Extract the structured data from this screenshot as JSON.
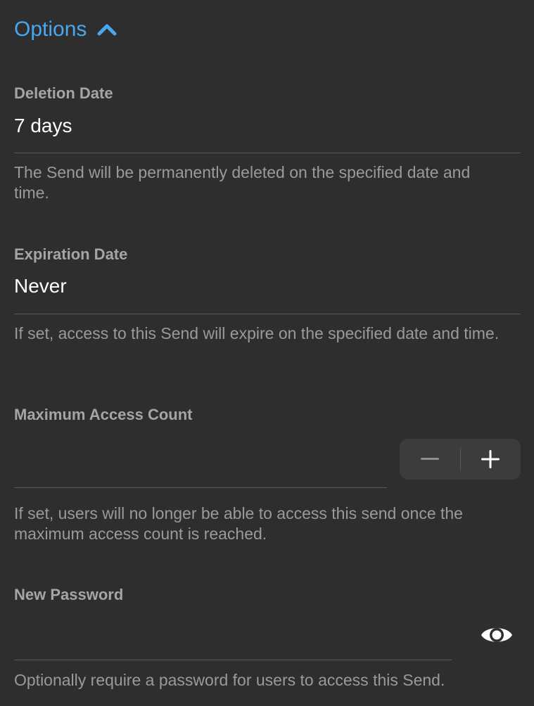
{
  "options": {
    "label": "Options",
    "expanded": true,
    "toggle_icon": "chevron-up-icon",
    "accent_color": "#48a8ef"
  },
  "deletion_date": {
    "label": "Deletion Date",
    "value": "7 days",
    "helper": "The Send will be permanently deleted on the specified date and time."
  },
  "expiration_date": {
    "label": "Expiration Date",
    "value": "Never",
    "helper": "If set, access to this Send will expire on the specified date and time."
  },
  "max_access_count": {
    "label": "Maximum Access Count",
    "value": "",
    "decrement_icon": "minus-icon",
    "increment_icon": "plus-icon",
    "helper": "If set, users will no longer be able to access this send once the maximum access count is reached."
  },
  "new_password": {
    "label": "New Password",
    "value": "",
    "toggle_icon": "eye-icon",
    "helper": "Optionally require a password for users to access this Send."
  },
  "colors": {
    "background": "#2e2e2e",
    "label": "#a5a5a5",
    "value": "#ffffff",
    "helper": "#9a9a9a",
    "divider": "#585858",
    "stepper_bg": "#3c3c3e"
  }
}
